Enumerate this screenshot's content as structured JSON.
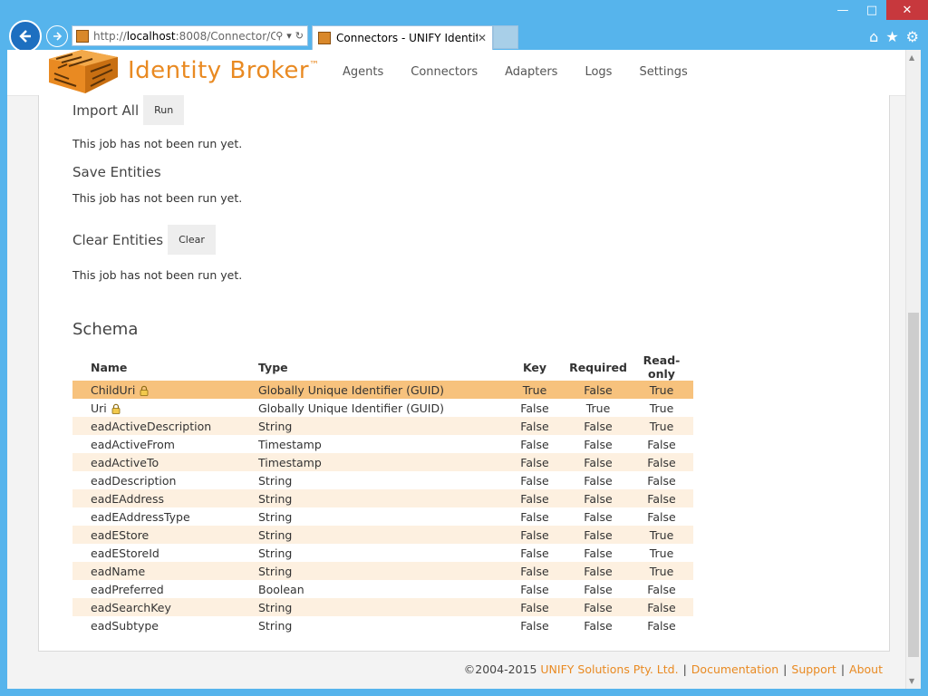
{
  "browser": {
    "address_host": "localhost",
    "address_prefix": "http://",
    "address_suffix": ":8008/Connector/C",
    "tab_title": "Connectors - UNIFY Identit..."
  },
  "header": {
    "logo_text": "Identity Broker",
    "logo_tm": "™",
    "nav": [
      "Agents",
      "Connectors",
      "Adapters",
      "Logs",
      "Settings"
    ]
  },
  "jobs": [
    {
      "label": "Import All",
      "button": "Run",
      "status": "This job has not been run yet."
    },
    {
      "label": "Save Entities",
      "button": "",
      "status": "This job has not been run yet."
    },
    {
      "label": "Clear Entities",
      "button": "Clear",
      "status": "This job has not been run yet."
    }
  ],
  "schema": {
    "title": "Schema",
    "headers": {
      "name": "Name",
      "type": "Type",
      "key": "Key",
      "required": "Required",
      "readonly": "Read-only"
    },
    "rows": [
      {
        "name": "ChildUri",
        "type": "Globally Unique Identifier (GUID)",
        "key": "True",
        "required": "False",
        "readonly": "True",
        "locked": true
      },
      {
        "name": "Uri",
        "type": "Globally Unique Identifier (GUID)",
        "key": "False",
        "required": "True",
        "readonly": "True",
        "locked": true
      },
      {
        "name": "eadActiveDescription",
        "type": "String",
        "key": "False",
        "required": "False",
        "readonly": "True"
      },
      {
        "name": "eadActiveFrom",
        "type": "Timestamp",
        "key": "False",
        "required": "False",
        "readonly": "False"
      },
      {
        "name": "eadActiveTo",
        "type": "Timestamp",
        "key": "False",
        "required": "False",
        "readonly": "False"
      },
      {
        "name": "eadDescription",
        "type": "String",
        "key": "False",
        "required": "False",
        "readonly": "False"
      },
      {
        "name": "eadEAddress",
        "type": "String",
        "key": "False",
        "required": "False",
        "readonly": "False"
      },
      {
        "name": "eadEAddressType",
        "type": "String",
        "key": "False",
        "required": "False",
        "readonly": "False"
      },
      {
        "name": "eadEStore",
        "type": "String",
        "key": "False",
        "required": "False",
        "readonly": "True"
      },
      {
        "name": "eadEStoreId",
        "type": "String",
        "key": "False",
        "required": "False",
        "readonly": "True"
      },
      {
        "name": "eadName",
        "type": "String",
        "key": "False",
        "required": "False",
        "readonly": "True"
      },
      {
        "name": "eadPreferred",
        "type": "Boolean",
        "key": "False",
        "required": "False",
        "readonly": "False"
      },
      {
        "name": "eadSearchKey",
        "type": "String",
        "key": "False",
        "required": "False",
        "readonly": "False"
      },
      {
        "name": "eadSubtype",
        "type": "String",
        "key": "False",
        "required": "False",
        "readonly": "False"
      }
    ]
  },
  "footer": {
    "copyright": "©2004-2015",
    "company": "UNIFY Solutions Pty. Ltd.",
    "links": [
      "Documentation",
      "Support",
      "About"
    ],
    "separator": "|"
  },
  "colors": {
    "brand_orange": "#e98a22",
    "row_selected": "#f7c27d",
    "row_alt": "#fdf0e0",
    "window_frame": "#56b4ec"
  }
}
